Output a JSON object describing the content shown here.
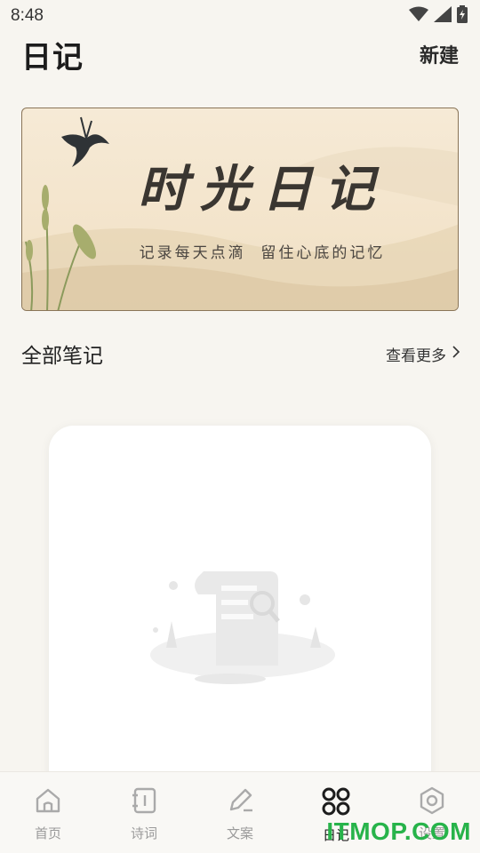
{
  "status_bar": {
    "time": "8:48",
    "icons": [
      "wifi-icon",
      "signal-icon",
      "battery-icon"
    ]
  },
  "header": {
    "title": "日记",
    "new_label": "新建"
  },
  "banner": {
    "title": "时光日记",
    "subtitle": "记录每天点滴  留住心底的记忆"
  },
  "section": {
    "title": "全部笔记",
    "more_label": "查看更多"
  },
  "empty_state": {
    "illustration": "empty-scroll-icon"
  },
  "tabs": [
    {
      "label": "首页",
      "icon": "home-icon",
      "active": false
    },
    {
      "label": "诗词",
      "icon": "notebook-icon",
      "active": false
    },
    {
      "label": "文案",
      "icon": "pen-icon",
      "active": false
    },
    {
      "label": "日记",
      "icon": "grid-icon",
      "active": true
    },
    {
      "label": "设置",
      "icon": "settings-icon",
      "active": false
    }
  ],
  "watermark": "ITMOP.COM",
  "colors": {
    "background": "#f7f5f0",
    "banner_bg": "#f3e4cb",
    "watermark": "#27b34a",
    "tab_active": "#222222",
    "tab_inactive": "#9a9a9a"
  }
}
